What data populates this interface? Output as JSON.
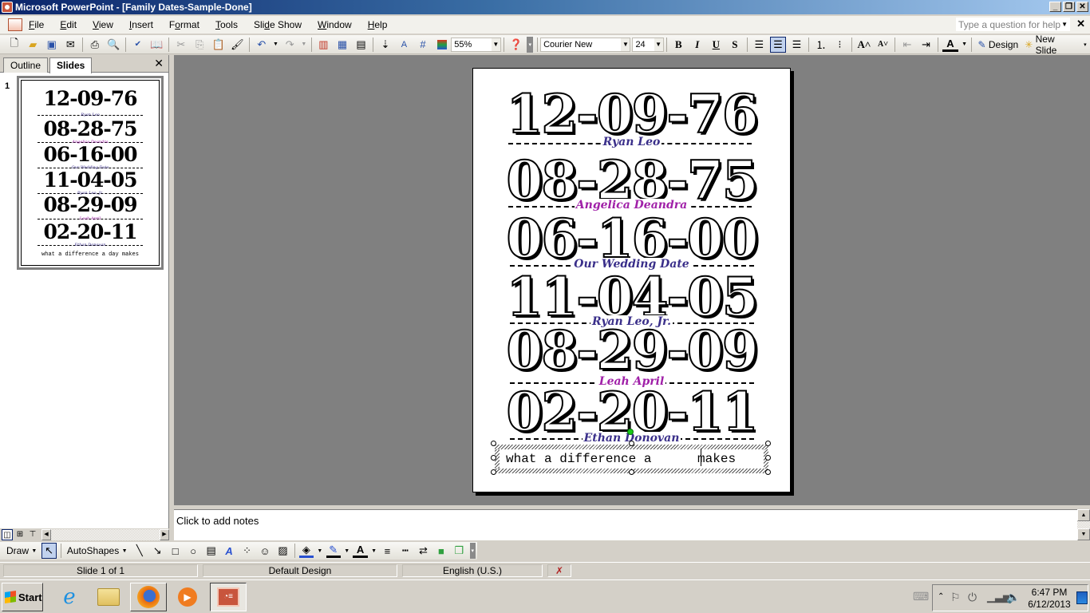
{
  "window": {
    "title": "Microsoft PowerPoint - [Family Dates-Sample-Done]",
    "buttons": [
      "_",
      "❐",
      "✕"
    ]
  },
  "menu": {
    "items": [
      {
        "label": "File",
        "u": "F",
        "rest": "ile"
      },
      {
        "label": "Edit",
        "u": "E",
        "rest": "dit"
      },
      {
        "label": "View",
        "u": "V",
        "rest": "iew"
      },
      {
        "label": "Insert",
        "u": "I",
        "rest": "nsert"
      },
      {
        "label": "Format",
        "pre": "F",
        "u": "o",
        "rest": "rmat"
      },
      {
        "label": "Tools",
        "u": "T",
        "rest": "ools"
      },
      {
        "label": "Slide Show",
        "pre": "Sli",
        "u": "d",
        "rest": "e Show"
      },
      {
        "label": "Window",
        "u": "W",
        "rest": "indow"
      },
      {
        "label": "Help",
        "u": "H",
        "rest": "elp"
      }
    ],
    "help_placeholder": "Type a question for help"
  },
  "toolbar": {
    "zoom": "55%",
    "font": "Courier New",
    "font_size": "24",
    "design_label": "Design",
    "new_slide_label": "New Slide"
  },
  "left_pane": {
    "tabs": [
      "Outline",
      "Slides"
    ],
    "active_tab": "Slides",
    "slide_number": "1"
  },
  "slide": {
    "entries": [
      {
        "date": "12-09-76",
        "name": "Ryan Leo",
        "color": "#3a2f8a"
      },
      {
        "date": "08-28-75",
        "name": "Angelica Deandra",
        "color": "#a020a8"
      },
      {
        "date": "06-16-00",
        "name": "Our Wedding Date",
        "color": "#3a2f8a"
      },
      {
        "date": "11-04-05",
        "name": "Ryan Leo, Jr.",
        "color": "#3a2f8a"
      },
      {
        "date": "08-29-09",
        "name": "Leah April",
        "color": "#a020a8"
      },
      {
        "date": "02-20-11",
        "name": "Ethan Donovan",
        "color": "#3a2f8a"
      }
    ],
    "tagline": "what a difference a      makes",
    "tagline_thumb": "what a difference a day makes"
  },
  "notes": {
    "placeholder": "Click to add notes"
  },
  "draw_toolbar": {
    "draw_label": "Draw",
    "autoshapes_label": "AutoShapes"
  },
  "status": {
    "slide": "Slide 1 of 1",
    "design": "Default Design",
    "language": "English (U.S.)"
  },
  "taskbar": {
    "start_label": "Start",
    "time": "6:47 PM",
    "date": "6/12/2013"
  }
}
